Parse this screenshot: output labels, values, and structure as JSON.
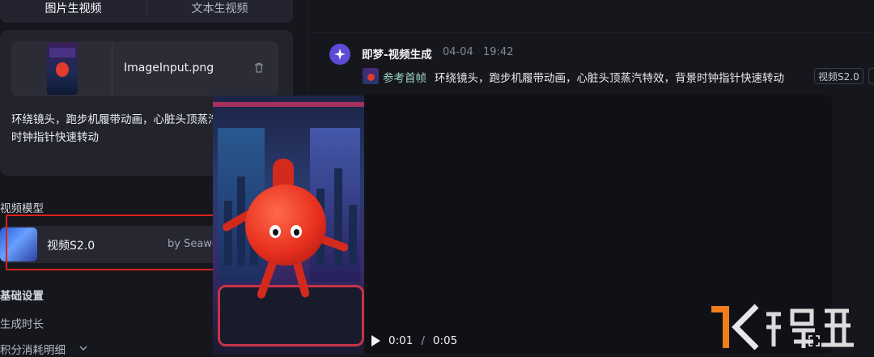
{
  "left_panel": {
    "tabs": [
      {
        "label": "图片生视频",
        "active": true
      },
      {
        "label": "文本生视频",
        "active": false
      }
    ],
    "upload": {
      "filename": "ImageInput.png",
      "prompt": "环绕镜头，跑步机履带动画，心脏头顶蒸汽特效，背景时钟指针快速转动"
    },
    "model_section": {
      "title": "视频模型",
      "model_name": "视频S2.0",
      "model_by": "by Seaweed alpha"
    },
    "basic_settings": {
      "title": "基础设置",
      "items": [
        "生成时长",
        "积分消耗明细"
      ]
    }
  },
  "chat": {
    "sender": "即梦-视频生成",
    "date": "04-04",
    "time": "19:42",
    "ref_label": "参考首帧",
    "prompt": "环绕镜头，跑步机履带动画，心脏头顶蒸汽特效，背景时钟指针快速转动",
    "tags": [
      "视频S2.0"
    ],
    "video": {
      "current_time": "0:01",
      "separator": "/",
      "duration": "0:05"
    }
  },
  "colors": {
    "background": "#16171d",
    "panel": "#22232b",
    "accent_avatar": "#5b4bd6",
    "highlight_box": "#d8231c",
    "ref_label": "#9ed6c6"
  }
}
